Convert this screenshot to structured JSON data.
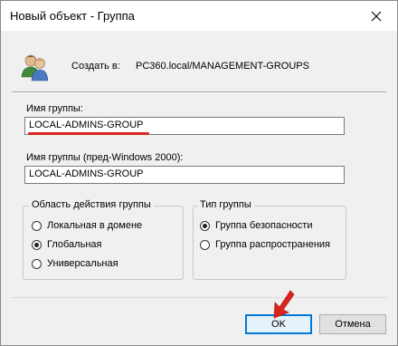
{
  "window": {
    "title": "Новый объект - Группа"
  },
  "header": {
    "create_label": "Создать в:",
    "path": "PC360.local/MANAGEMENT-GROUPS"
  },
  "group_name": {
    "label": "Имя группы:",
    "value": "LOCAL-ADMINS-GROUP"
  },
  "group_name_pre2000": {
    "label": "Имя группы (пред-Windows 2000):",
    "value": "LOCAL-ADMINS-GROUP"
  },
  "scope": {
    "title": "Область действия группы",
    "options": [
      "Локальная в домене",
      "Глобальная",
      "Универсальная"
    ],
    "selected": "Глобальная"
  },
  "type": {
    "title": "Тип группы",
    "options": [
      "Группа безопасности",
      "Группа распространения"
    ],
    "selected": "Группа безопасности"
  },
  "buttons": {
    "ok": "OK",
    "cancel": "Отмена"
  },
  "colors": {
    "annotation": "#d9251d",
    "focus": "#0078d7"
  }
}
